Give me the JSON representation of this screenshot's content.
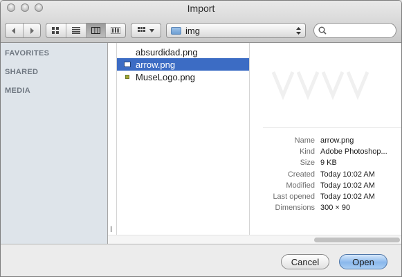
{
  "window": {
    "title": "Import"
  },
  "toolbar": {
    "back_icon": "chevron-left-icon",
    "forward_icon": "chevron-right-icon",
    "view_modes": [
      "icon-view",
      "list-view",
      "column-view",
      "cover-flow-view"
    ],
    "active_view": "column-view",
    "arrange_icon": "grid-icon",
    "location": "img",
    "search": {
      "value": "",
      "placeholder": ""
    }
  },
  "sidebar": {
    "sections": [
      "FAVORITES",
      "SHARED",
      "MEDIA"
    ]
  },
  "files": [
    {
      "name": "absurdidad.png",
      "selected": false
    },
    {
      "name": "arrow.png",
      "selected": true
    },
    {
      "name": "MuseLogo.png",
      "selected": false
    }
  ],
  "preview": {
    "info": [
      {
        "key": "Name",
        "value": "arrow.png"
      },
      {
        "key": "Kind",
        "value": "Adobe Photoshop..."
      },
      {
        "key": "Size",
        "value": "9 KB"
      },
      {
        "key": "Created",
        "value": "Today 10:02 AM"
      },
      {
        "key": "Modified",
        "value": "Today 10:02 AM"
      },
      {
        "key": "Last opened",
        "value": "Today 10:02 AM"
      },
      {
        "key": "Dimensions",
        "value": "300 × 90"
      }
    ]
  },
  "buttons": {
    "cancel": "Cancel",
    "open": "Open"
  },
  "colors": {
    "selection": "#3c6cc4",
    "default_button": "#8ab8ec",
    "sidebar": "#dee4ea"
  }
}
